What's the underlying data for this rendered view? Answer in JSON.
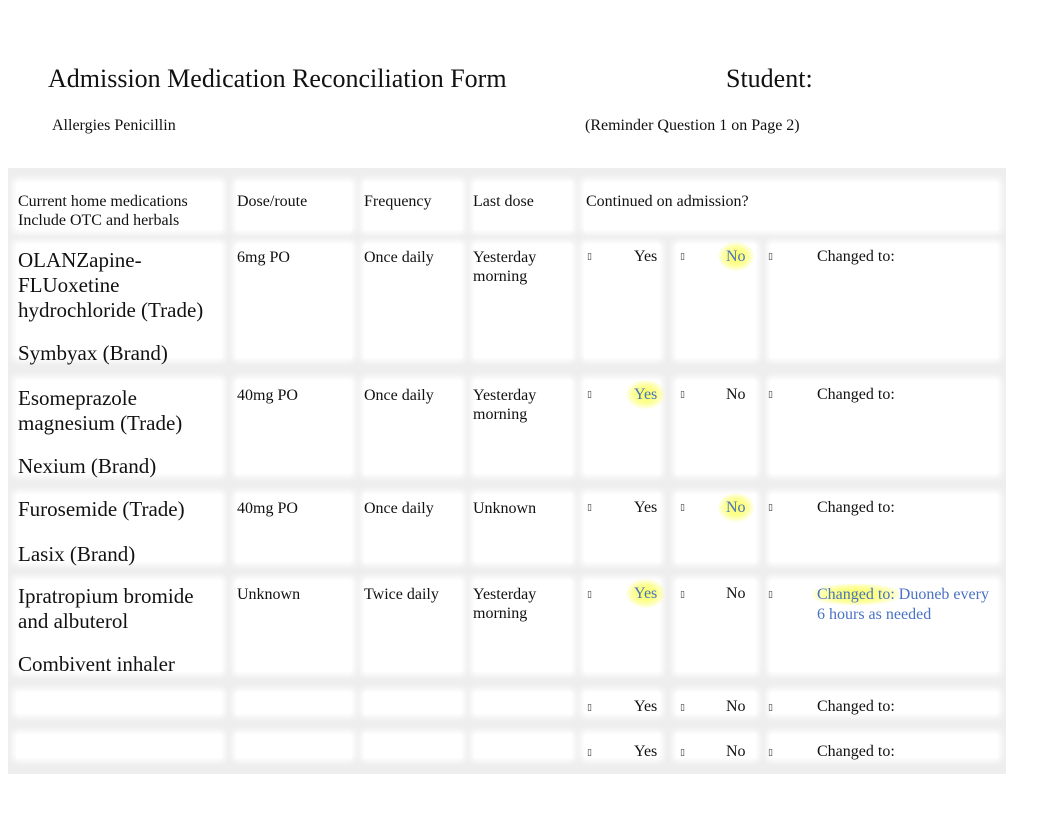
{
  "header": {
    "title": "Admission Medication Reconciliation Form",
    "student_label": "Student:",
    "allergies": "Allergies Penicillin",
    "reminder": "(Reminder Question 1 on Page 2)"
  },
  "table": {
    "columns": {
      "medications_line1": "Current home medications",
      "medications_line2": "Include OTC and herbals",
      "dose": "Dose/route",
      "frequency": "Frequency",
      "last_dose": "Last dose",
      "continued": "Continued on admission?"
    },
    "checkbox_glyph": "▯",
    "yes_label": "Yes",
    "no_label": "No",
    "changed_label": "Changed to:",
    "rows": [
      {
        "trade_lines": [
          "OLANZapine-",
          "FLUoxetine",
          "hydrochloride (Trade)"
        ],
        "brand": "Symbyax (Brand)",
        "dose": "6mg PO",
        "frequency": "Once daily",
        "last_dose_lines": [
          "Yesterday",
          "morning"
        ],
        "selected": "No",
        "changed_to": ""
      },
      {
        "trade_lines": [
          "Esomeprazole",
          "magnesium (Trade)"
        ],
        "brand": "Nexium (Brand)",
        "dose": "40mg PO",
        "frequency": "Once daily",
        "last_dose_lines": [
          "Yesterday",
          "morning"
        ],
        "selected": "Yes",
        "changed_to": ""
      },
      {
        "trade_lines": [
          "Furosemide (Trade)"
        ],
        "brand": "Lasix (Brand)",
        "dose": "40mg PO",
        "frequency": "Once daily",
        "last_dose_lines": [
          "Unknown"
        ],
        "selected": "No",
        "changed_to": ""
      },
      {
        "trade_lines": [
          "Ipratropium bromide",
          "and albuterol"
        ],
        "brand": "Combivent inhaler",
        "dose": "Unknown",
        "frequency": "Twice daily",
        "last_dose_lines": [
          "Yesterday",
          "morning"
        ],
        "selected": "Yes",
        "changed_to_lines": [
          "Duoneb every",
          "6 hours as needed"
        ]
      },
      {
        "selected": ""
      },
      {
        "selected": ""
      }
    ]
  },
  "colors": {
    "highlight": "#fbff5c",
    "answer_text": "#4a72c4",
    "gridline": "#e8e8e8"
  }
}
